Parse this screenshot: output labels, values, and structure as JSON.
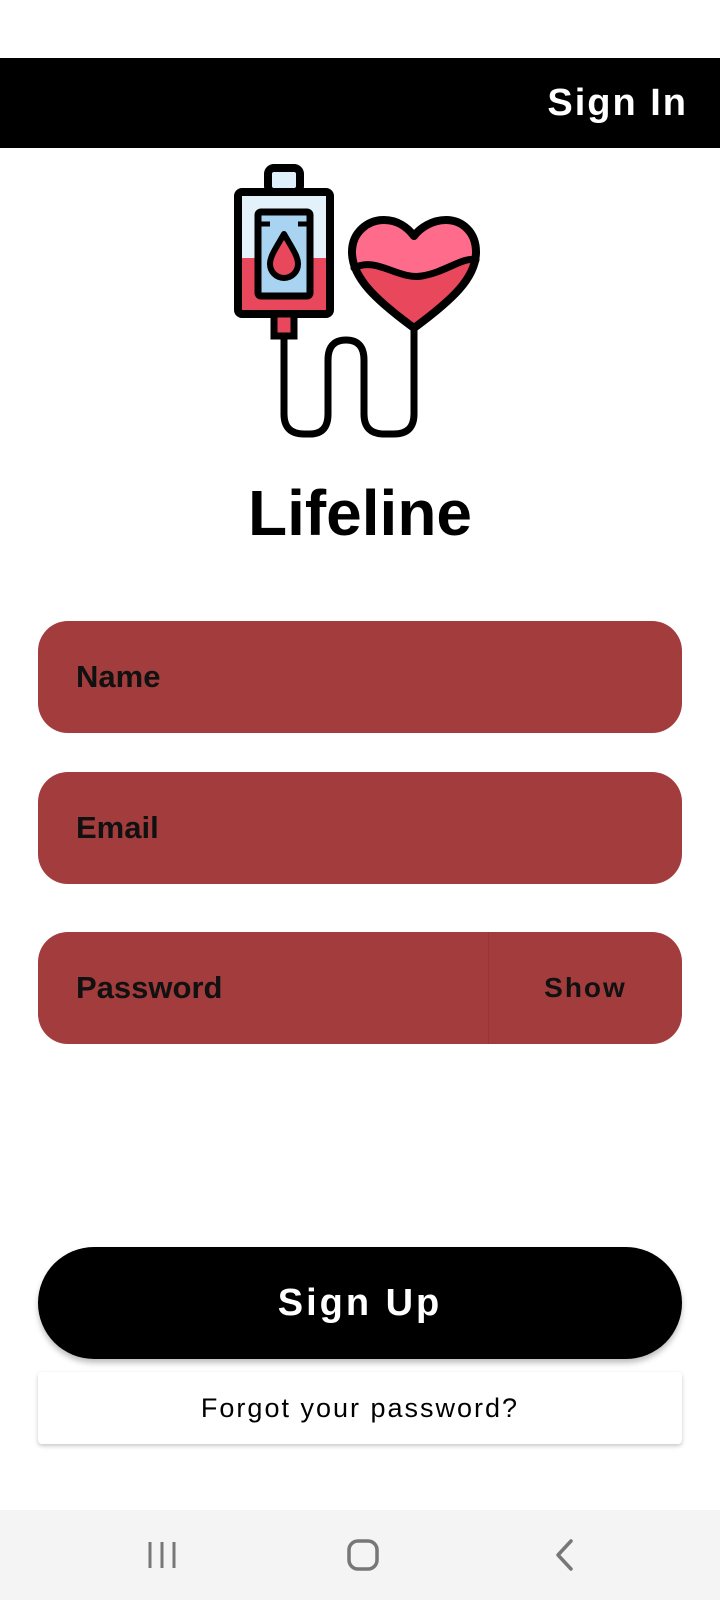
{
  "header": {
    "signin_label": "Sign In"
  },
  "app": {
    "name": "Lifeline"
  },
  "form": {
    "name_placeholder": "Name",
    "email_placeholder": "Email",
    "password_placeholder": "Password",
    "show_label": "Show"
  },
  "actions": {
    "signup_label": "Sign Up",
    "forgot_label": "Forgot your password?"
  },
  "colors": {
    "header_bg": "#000000",
    "field_bg": "#a33c3c",
    "primary_button_bg": "#000000",
    "nav_bar_bg": "#f4f4f4"
  },
  "icons": {
    "logo": "blood-bag-heart-icon",
    "nav_recent": "recent-apps-icon",
    "nav_home": "home-icon",
    "nav_back": "back-icon"
  }
}
